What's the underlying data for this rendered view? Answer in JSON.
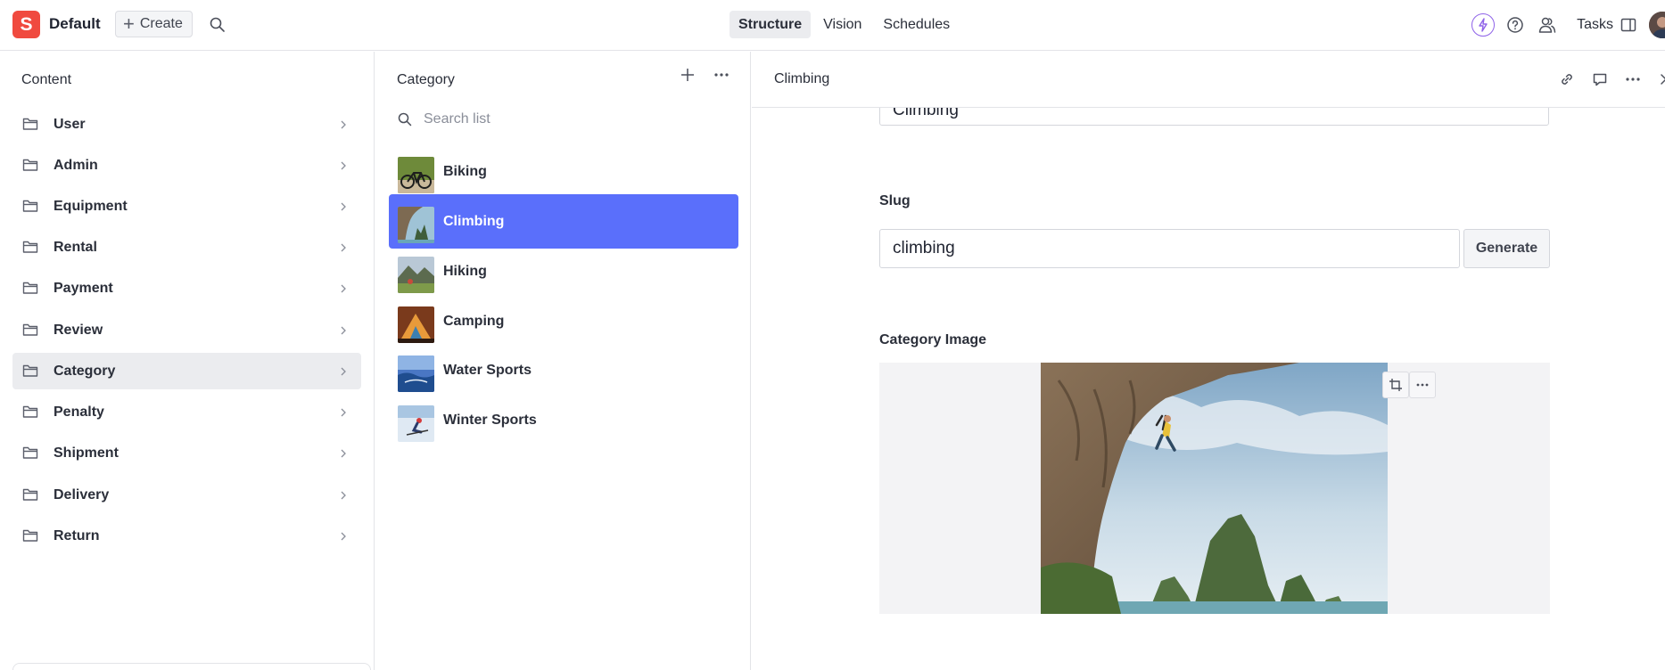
{
  "topbar": {
    "logo_letter": "S",
    "workspace": "Default",
    "create_label": "Create",
    "tabs": [
      {
        "label": "Structure",
        "active": true
      },
      {
        "label": "Vision",
        "active": false
      },
      {
        "label": "Schedules",
        "active": false
      }
    ],
    "tasks_label": "Tasks",
    "icons": [
      "search-icon",
      "bolt-icon",
      "help-icon",
      "people-icon",
      "panel-icon"
    ]
  },
  "content_pane": {
    "title": "Content",
    "items": [
      {
        "label": "User"
      },
      {
        "label": "Admin"
      },
      {
        "label": "Equipment"
      },
      {
        "label": "Rental"
      },
      {
        "label": "Payment"
      },
      {
        "label": "Review"
      },
      {
        "label": "Category",
        "selected": true
      },
      {
        "label": "Penalty"
      },
      {
        "label": "Shipment"
      },
      {
        "label": "Delivery"
      },
      {
        "label": "Return"
      }
    ]
  },
  "list_pane": {
    "title": "Category",
    "search_placeholder": "Search list",
    "items": [
      {
        "label": "Biking"
      },
      {
        "label": "Climbing",
        "selected": true
      },
      {
        "label": "Hiking"
      },
      {
        "label": "Camping"
      },
      {
        "label": "Water Sports"
      },
      {
        "label": "Winter Sports"
      }
    ]
  },
  "document_pane": {
    "title": "Climbing",
    "title_field_value": "Climbing",
    "slug_label": "Slug",
    "slug_value": "climbing",
    "generate_label": "Generate",
    "image_label": "Category Image"
  },
  "colors": {
    "accent": "#5a6ffb",
    "logo": "#f04a3f",
    "bolt": "#8f63e8"
  }
}
